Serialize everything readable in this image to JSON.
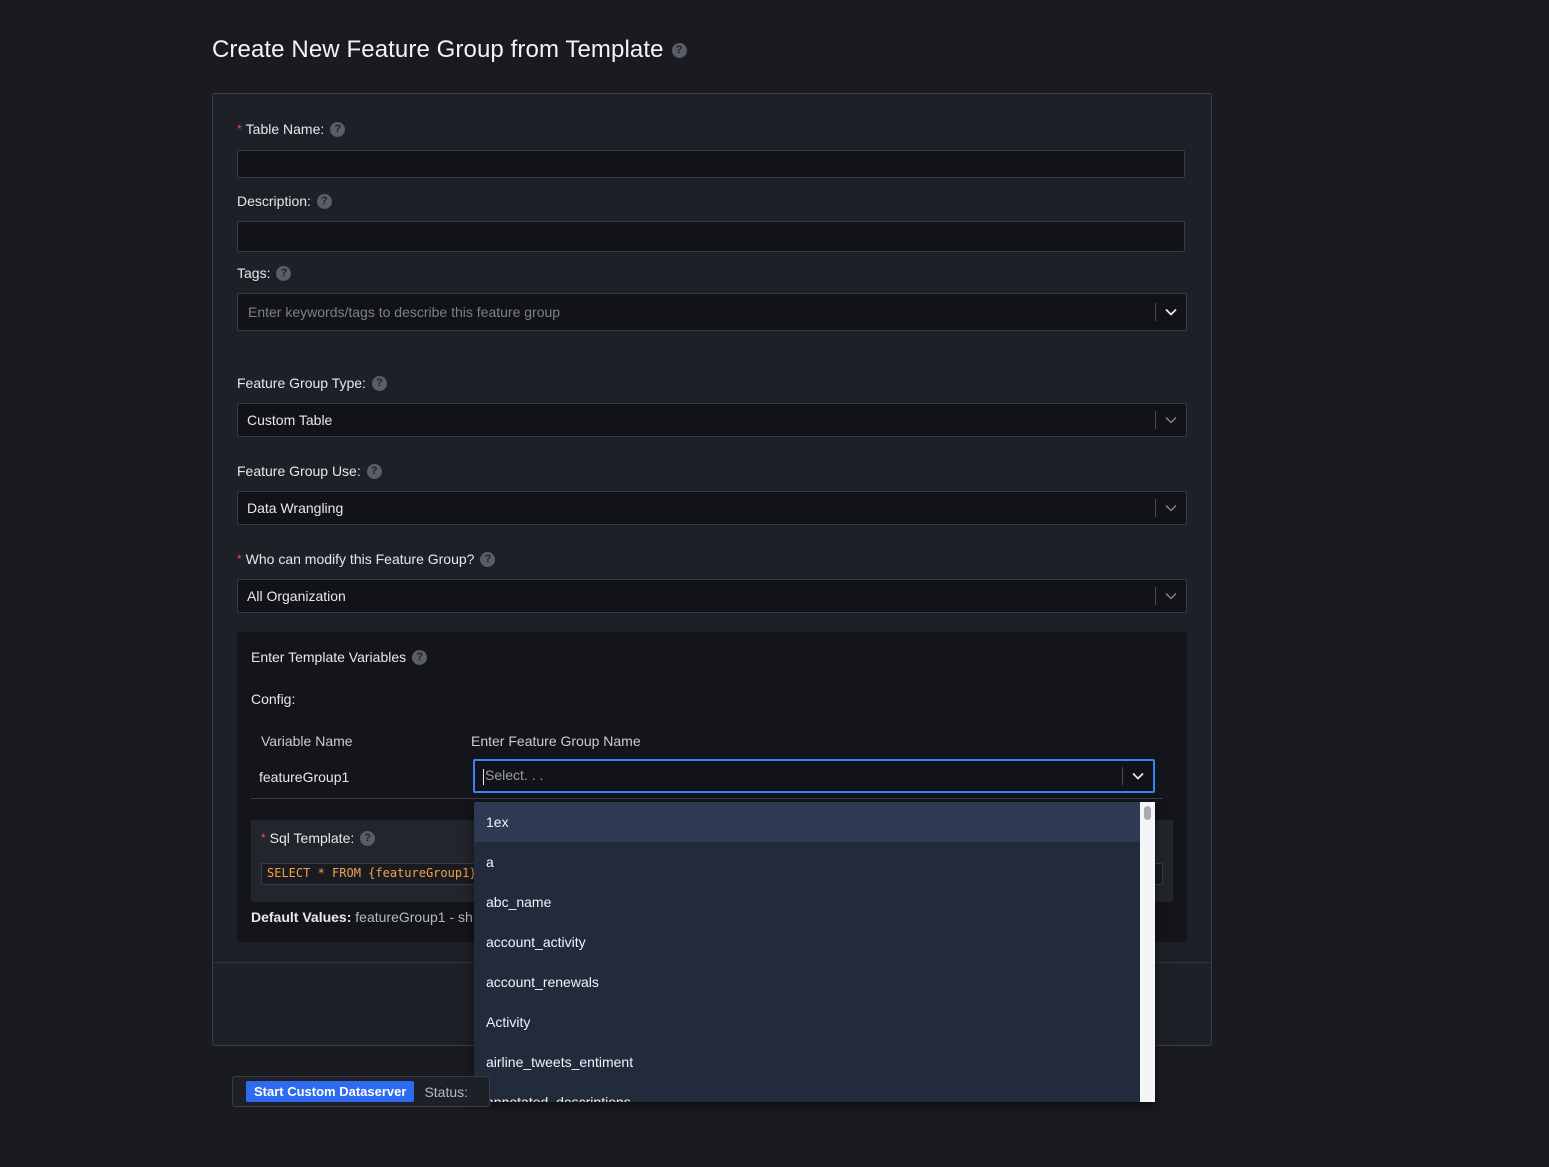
{
  "page": {
    "title": "Create New Feature Group from Template",
    "help_glyph": "?"
  },
  "form": {
    "table_name": {
      "label": "Table Name:",
      "required_mark": "*",
      "value": ""
    },
    "description": {
      "label": "Description:",
      "value": ""
    },
    "tags": {
      "label": "Tags:",
      "placeholder": "Enter keywords/tags to describe this feature group"
    },
    "feature_group_type": {
      "label": "Feature Group Type:",
      "value": "Custom Table"
    },
    "feature_group_use": {
      "label": "Feature Group Use:",
      "value": "Data Wrangling"
    },
    "modify_permission": {
      "label": "Who can modify this Feature Group?",
      "required_mark": "*",
      "value": "All Organization"
    }
  },
  "template": {
    "section_title": "Enter Template Variables",
    "config_label": "Config:",
    "columns": [
      "Variable Name",
      "Enter Feature Group Name"
    ],
    "rows": [
      {
        "variable": "featureGroup1",
        "placeholder": "Select. . ."
      }
    ],
    "sql_label": "Sql Template:",
    "sql_required_mark": "*",
    "sql_code": "SELECT * FROM {featureGroup1}",
    "defaults_label": "Default Values:",
    "defaults_value": "featureGroup1 -  sh"
  },
  "dropdown": {
    "options": [
      "1ex",
      "a",
      "abc_name",
      "account_activity",
      "account_renewals",
      "Activity",
      "airline_tweets_entiment",
      "annotated_descriptions"
    ],
    "highlighted_index": 0
  },
  "bottom_bar": {
    "button_label": "Start Custom Dataserver",
    "status_label": "Status:"
  },
  "colors": {
    "background": "#1a1b20",
    "accent": "#2f6bf0",
    "focus_border": "#3b82f6",
    "required": "#e05555",
    "sql_text": "#f0a24b",
    "dropdown_bg": "#222b3b"
  },
  "icons": {
    "help": "question-circle-icon",
    "chevron": "chevron-down-icon"
  }
}
